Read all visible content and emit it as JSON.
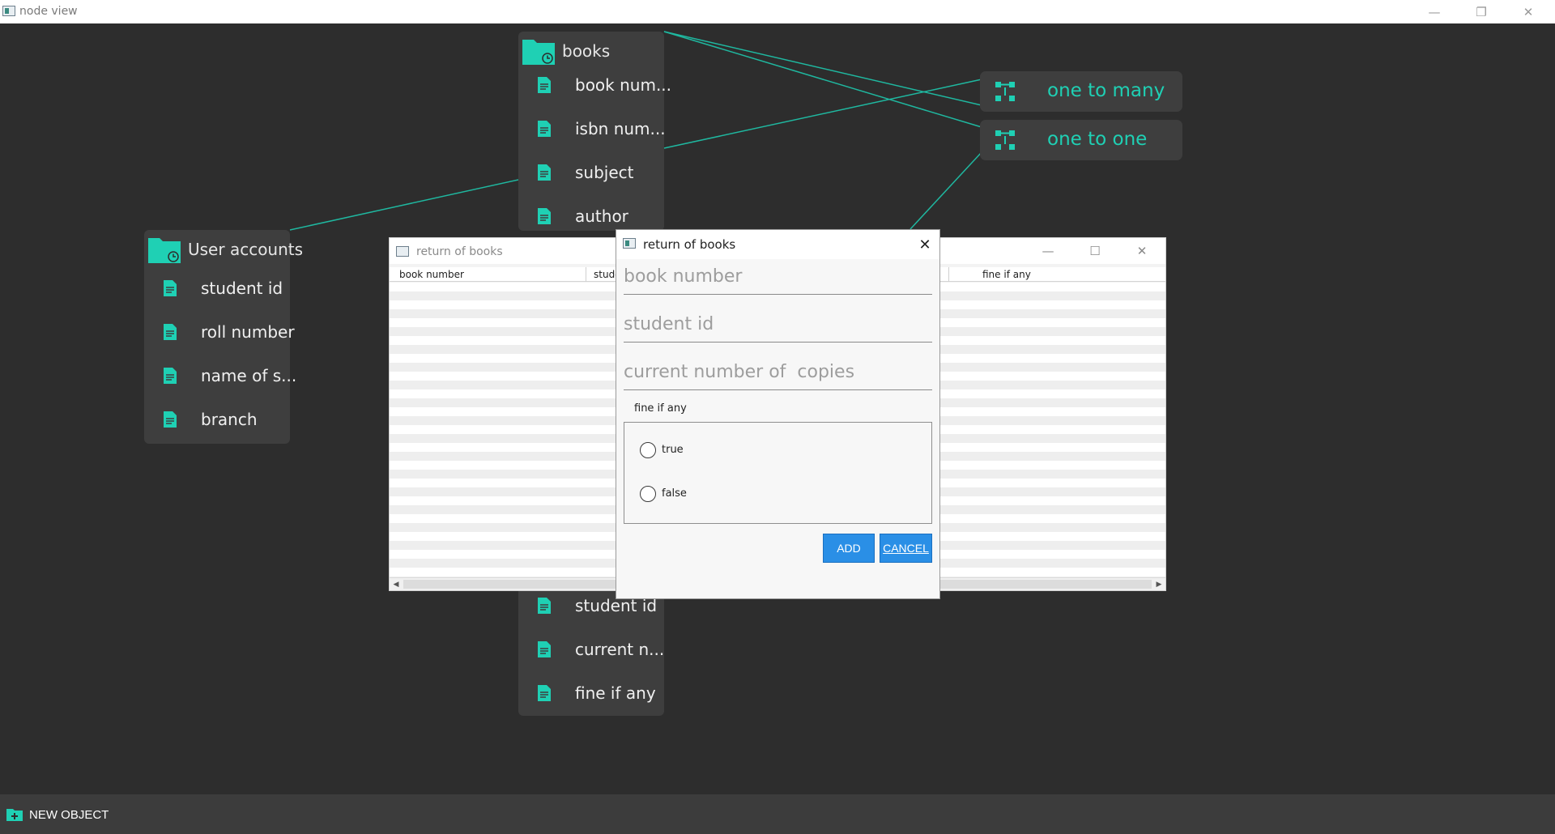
{
  "window": {
    "title": "node view",
    "minimize": "—",
    "restore": "❐",
    "close": "✕"
  },
  "nodes": {
    "books": {
      "title": "books",
      "fields": [
        "book num...",
        "isbn num...",
        "subject",
        "author"
      ]
    },
    "user_accounts": {
      "title": "User accounts",
      "fields": [
        "student id",
        "roll number",
        "name of s...",
        "branch"
      ]
    },
    "return_of_books": {
      "fields": [
        "student id",
        "current n...",
        "fine if any"
      ]
    }
  },
  "relations": {
    "one_to_many": "one to many",
    "one_to_one": "one to one"
  },
  "table_window": {
    "title": "return of books",
    "columns": [
      "book number",
      "stude",
      "fine if any"
    ],
    "minimize": "—",
    "maximize": "☐",
    "close": "✕"
  },
  "dialog": {
    "title": "return of books",
    "close": "✕",
    "book_number_placeholder": "book number",
    "student_id_placeholder": "student id",
    "copies_placeholder": "current number of  copies",
    "group_label": "fine if any",
    "options": [
      "true",
      "false"
    ],
    "add_label": "ADD",
    "cancel_label": "CANCEL"
  },
  "bottom_bar": {
    "new_object_label": "NEW OBJECT"
  },
  "colors": {
    "accent": "#1fd0b4",
    "background": "#2d2d2d",
    "node_bg": "#3e3e3e",
    "button": "#2a8fe6"
  }
}
